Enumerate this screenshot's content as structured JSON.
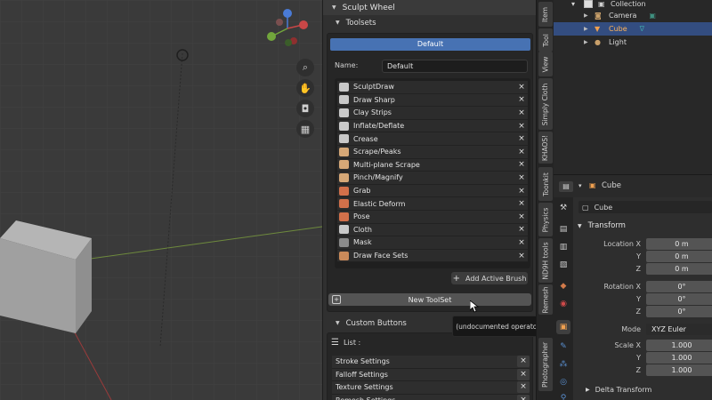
{
  "sculpt_panel": {
    "title": "Sculpt Wheel",
    "toolsets_header": "Toolsets",
    "active_toolset": "Default",
    "name_label": "Name:",
    "name_value": "Default",
    "brushes": [
      {
        "name": "SculptDraw",
        "icon_color": "#c9c9c9"
      },
      {
        "name": "Draw Sharp",
        "icon_color": "#c9c9c9"
      },
      {
        "name": "Clay Strips",
        "icon_color": "#c9c9c9"
      },
      {
        "name": "Inflate/Deflate",
        "icon_color": "#c9c9c9"
      },
      {
        "name": "Crease",
        "icon_color": "#c9c9c9"
      },
      {
        "name": "Scrape/Peaks",
        "icon_color": "#d6a877"
      },
      {
        "name": "Multi-plane Scrape",
        "icon_color": "#d6a877"
      },
      {
        "name": "Pinch/Magnify",
        "icon_color": "#d6a877"
      },
      {
        "name": "Grab",
        "icon_color": "#d2704a"
      },
      {
        "name": "Elastic Deform",
        "icon_color": "#d2704a"
      },
      {
        "name": "Pose",
        "icon_color": "#d2704a"
      },
      {
        "name": "Cloth",
        "icon_color": "#c9c9c9"
      },
      {
        "name": "Mask",
        "icon_color": "#8a8a8a"
      },
      {
        "name": "Draw Face Sets",
        "icon_color": "#c98a5a"
      }
    ],
    "remove_glyph": "×",
    "add_active_brush": "Add Active Brush",
    "new_toolset": "New ToolSet",
    "custom_buttons_header": "Custom Buttons",
    "list_label": "List :",
    "custom_list": [
      "Stroke Settings",
      "Falloff Settings",
      "Texture Settings",
      "Remesh Settings"
    ]
  },
  "tooltip": "(undocumented operator).",
  "vertical_tabs": [
    "Item",
    "Tool",
    "View",
    "Simply Cloth",
    "KHAOS!",
    "Toonkit",
    "Physics",
    "ND9H tools",
    "Remesh",
    "Photographer"
  ],
  "outliner": {
    "collection": "Collection",
    "items": [
      {
        "name": "Camera",
        "selected": false
      },
      {
        "name": "Cube",
        "selected": true
      },
      {
        "name": "Light",
        "selected": false
      }
    ]
  },
  "properties": {
    "object_header": "Cube",
    "object_name": "Cube",
    "transform_header": "Transform",
    "location_label": "Location X",
    "location": [
      "0 m",
      "0 m",
      "0 m"
    ],
    "rotation_label": "Rotation X",
    "rotation": [
      "0°",
      "0°",
      "0°"
    ],
    "mode_label": "Mode",
    "mode_value": "XYZ Euler",
    "scale_label": "Scale X",
    "scale": [
      "1.000",
      "1.000",
      "1.000"
    ],
    "axis_y": "Y",
    "axis_z": "Z",
    "delta_transform": "Delta Transform"
  },
  "colors": {
    "accent_blue": "#4772b3",
    "selection": "#334d80",
    "orange_text": "#ffb35a"
  }
}
